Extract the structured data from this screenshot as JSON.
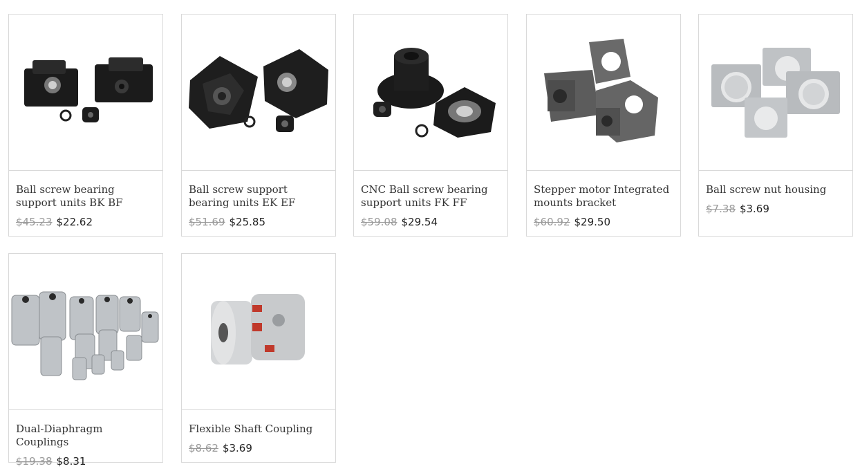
{
  "products": [
    {
      "title": "Ball screw bearing support units BK BF",
      "old_price": "$45.23",
      "price": "$22.62",
      "icon": "bk-bf-bearing-support-icon"
    },
    {
      "title": "Ball screw support bearing units EK EF",
      "old_price": "$51.69",
      "price": "$25.85",
      "icon": "ek-ef-bearing-support-icon"
    },
    {
      "title": "CNC Ball screw bearing support units FK FF",
      "old_price": "$59.08",
      "price": "$29.54",
      "icon": "fk-ff-bearing-support-icon"
    },
    {
      "title": "Stepper motor Integrated mounts bracket",
      "old_price": "$60.92",
      "price": "$29.50",
      "icon": "motor-bracket-icon"
    },
    {
      "title": "Ball screw nut housing",
      "old_price": "$7.38",
      "price": "$3.69",
      "icon": "nut-housing-icon"
    },
    {
      "title": "Dual-Diaphragm Couplings",
      "old_price": "$19.38",
      "price": "$8.31",
      "icon": "diaphragm-coupling-icon"
    },
    {
      "title": "Flexible Shaft Coupling",
      "old_price": "$8.62",
      "price": "$3.69",
      "icon": "shaft-coupling-icon"
    }
  ]
}
